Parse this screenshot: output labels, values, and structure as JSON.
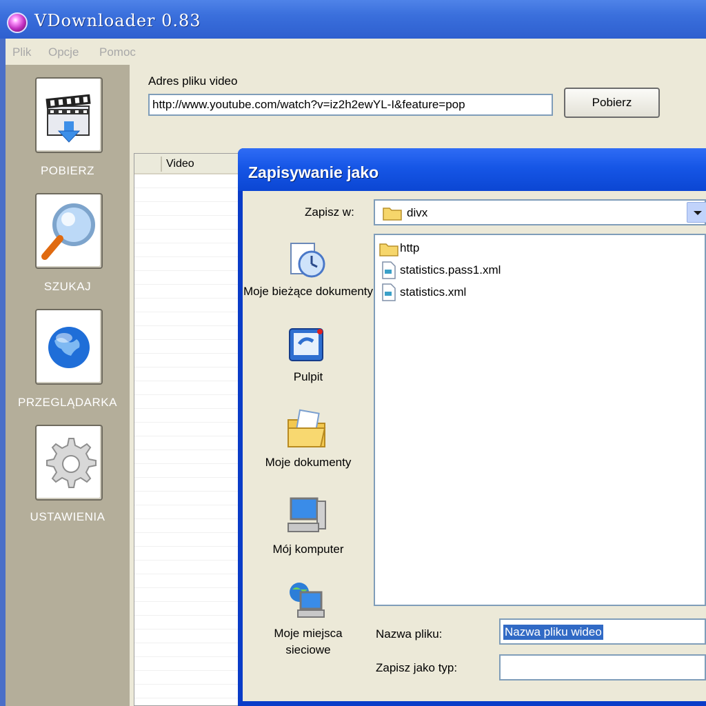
{
  "app": {
    "title": "VDownloader 0.83"
  },
  "menu": {
    "items": [
      "Plik",
      "Opcje",
      "Pomoc"
    ]
  },
  "sidebar": {
    "items": [
      {
        "label": "POBIERZ",
        "icon": "film-download-icon"
      },
      {
        "label": "SZUKAJ",
        "icon": "magnifier-icon"
      },
      {
        "label": "PRZEGLĄDARKA",
        "icon": "globe-icon"
      },
      {
        "label": "USTAWIENIA",
        "icon": "gear-icon"
      }
    ]
  },
  "address": {
    "label": "Adres pliku video",
    "value": "http://www.youtube.com/watch?v=iz2h2ewYL-I&feature=pop",
    "button": "Pobierz"
  },
  "list": {
    "columns": [
      "Video"
    ]
  },
  "dialog": {
    "title": "Zapisywanie jako",
    "save_in_label": "Zapisz w:",
    "save_in_value": "divx",
    "places": [
      {
        "label": "Moje bieżące dokumenty",
        "icon": "recent-documents-icon"
      },
      {
        "label": "Pulpit",
        "icon": "desktop-icon"
      },
      {
        "label": "Moje dokumenty",
        "icon": "my-documents-icon"
      },
      {
        "label": "Mój komputer",
        "icon": "my-computer-icon"
      },
      {
        "label": "Moje miejsca sieciowe",
        "icon": "network-places-icon"
      }
    ],
    "files": [
      {
        "name": "http",
        "icon": "folder-icon"
      },
      {
        "name": "statistics.pass1.xml",
        "icon": "xml-file-icon"
      },
      {
        "name": "statistics.xml",
        "icon": "xml-file-icon"
      }
    ],
    "filename_label": "Nazwa pliku:",
    "filename_value": "Nazwa pliku wideo",
    "filetype_label": "Zapisz jako typ:",
    "filetype_value": ""
  },
  "colors": {
    "titlebar": "#3a6fdc",
    "dialog_titlebar": "#1656e6",
    "sidebar": "#b4ae9a",
    "face": "#ece9d8",
    "selection": "#316ac5"
  }
}
